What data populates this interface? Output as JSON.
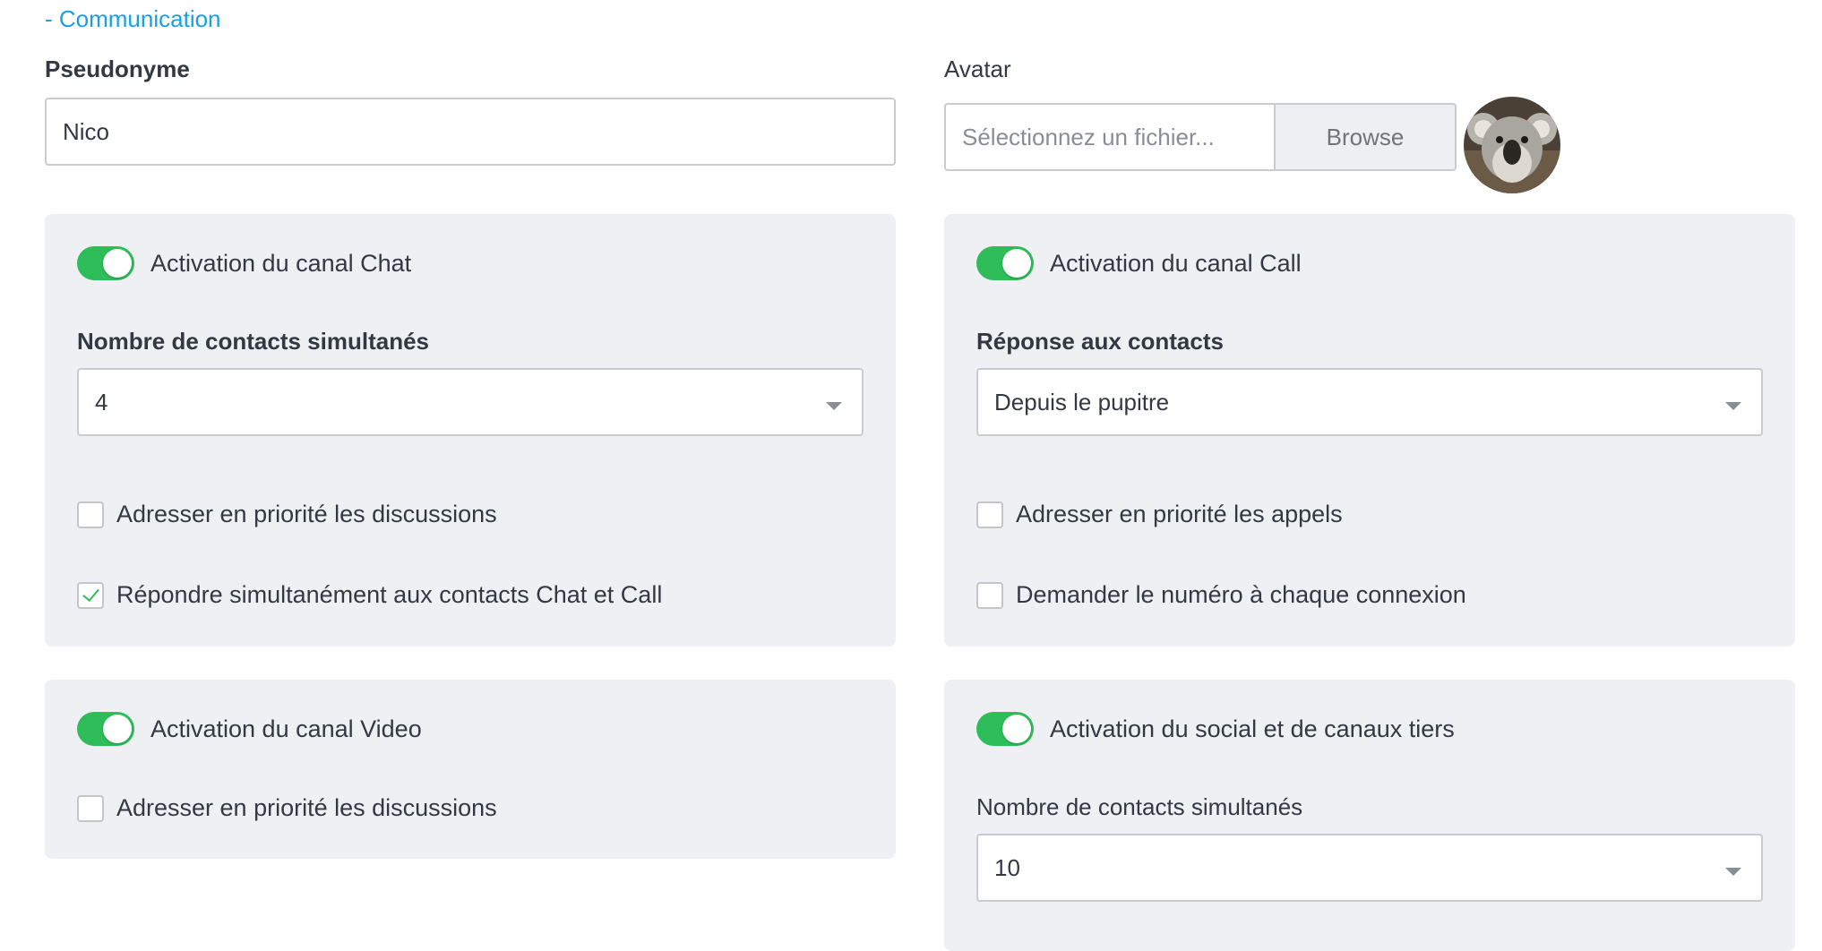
{
  "section": {
    "link": "- Communication"
  },
  "pseudonyme": {
    "label": "Pseudonyme",
    "value": "Nico"
  },
  "avatar": {
    "label": "Avatar",
    "placeholder": "Sélectionnez un fichier...",
    "browse": "Browse"
  },
  "chat": {
    "toggle_label": "Activation du canal Chat",
    "enabled": true,
    "contacts_label": "Nombre de contacts simultanés",
    "contacts_value": "4",
    "option1": "Adresser en priorité les discussions",
    "option1_checked": false,
    "option2": "Répondre simultanément aux contacts Chat et Call",
    "option2_checked": true
  },
  "call": {
    "toggle_label": "Activation du canal Call",
    "enabled": true,
    "response_label": "Réponse aux contacts",
    "response_value": "Depuis le pupitre",
    "option1": "Adresser en priorité les appels",
    "option1_checked": false,
    "option2": "Demander le numéro à chaque connexion",
    "option2_checked": false
  },
  "video": {
    "toggle_label": "Activation du canal Video",
    "enabled": true,
    "option1": "Adresser en priorité les discussions",
    "option1_checked": false
  },
  "social": {
    "toggle_label": "Activation du social et de canaux tiers",
    "enabled": true,
    "contacts_label": "Nombre de contacts simultanés",
    "contacts_value": "10"
  },
  "colors": {
    "accent": "#2ebd59",
    "link": "#1a9fe0",
    "panel": "#eff0f4"
  }
}
